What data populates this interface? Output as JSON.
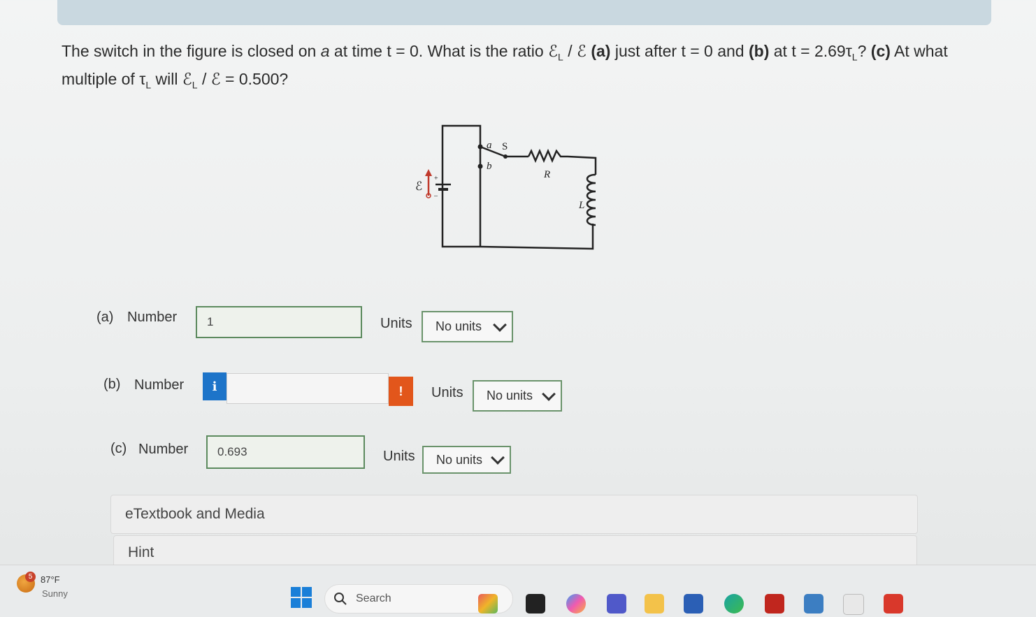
{
  "question": {
    "p1": "The switch in the figure is closed on ",
    "a": "a",
    "p2": " at time t = 0. What is the ratio ",
    "emf": "ℰ",
    "L": "L",
    "p3": " / ℰ ",
    "pa": "(a)",
    "p4": " just after t = 0 and ",
    "pb": "(b)",
    "p5": " at t = 2.69τ",
    "p6": "? ",
    "pc": "(c)",
    "p7": " At what multiple of τ",
    "p8": " will ℰ",
    "p9": " / ℰ = 0.500?"
  },
  "figure": {
    "a": "a",
    "s": "S",
    "b": "b",
    "r": "R",
    "l": "L",
    "emf": "ℰ",
    "plus": "+",
    "minus": "–"
  },
  "parts": [
    {
      "label": "(a)",
      "number_label": "Number",
      "value": "1",
      "units_label": "Units",
      "units": "No units"
    },
    {
      "label": "(b)",
      "number_label": "Number",
      "value": "",
      "units_label": "Units",
      "units": "No units",
      "info": "i",
      "warn": "!"
    },
    {
      "label": "(c)",
      "number_label": "Number",
      "value": "0.693",
      "units_label": "Units",
      "units": "No units"
    }
  ],
  "panels": {
    "etextbook": "eTextbook and Media",
    "hint": "Hint"
  },
  "taskbar": {
    "temp": "87°F",
    "condition": "Sunny",
    "badge": "5",
    "search_placeholder": "Search",
    "apps": [
      "widgets-app",
      "file-explorer-app",
      "copilot-app",
      "teams-app",
      "folder-app",
      "word-app",
      "edge-app",
      "red-app",
      "store-app",
      "calendar-app",
      "mail-app"
    ]
  }
}
